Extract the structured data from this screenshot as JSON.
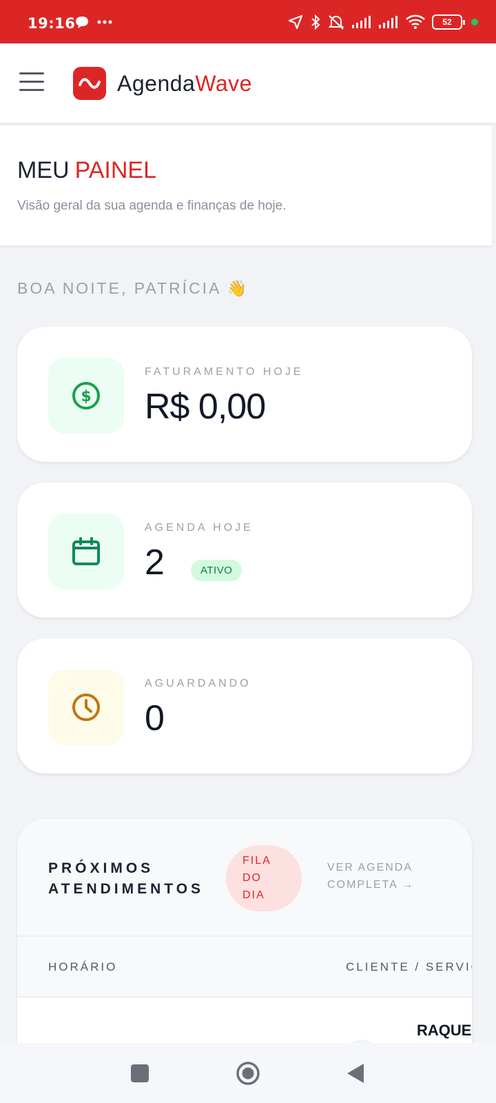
{
  "statusbar": {
    "time": "19:16",
    "battery": "52",
    "icons": [
      "chat-bubble-icon",
      "more-dots-icon",
      "location-arrow-icon",
      "bluetooth-icon",
      "mute-icon",
      "signal-icon",
      "signal-icon",
      "wifi-icon",
      "battery-icon"
    ]
  },
  "app": {
    "brand_part1": "Agenda",
    "brand_part2": "Wave",
    "accent_color": "#dc2626"
  },
  "page": {
    "title_part1": "MEU",
    "title_part2": "PAINEL",
    "subtitle": "Visão geral da sua agenda e finanças de hoje."
  },
  "greeting": "BOA NOITE, PATRÍCIA 👋",
  "stats": [
    {
      "label": "FATURAMENTO HOJE",
      "value": "R$ 0,00",
      "icon": "dollar-icon"
    },
    {
      "label": "AGENDA HOJE",
      "value": "2",
      "badge": "ATIVO",
      "icon": "calendar-icon"
    },
    {
      "label": "AGUARDANDO",
      "value": "0",
      "icon": "clock-icon"
    }
  ],
  "upcoming": {
    "title_line1": "PRÓXIMOS",
    "title_line2": "ATENDIMENTOS",
    "badge_line1": "FILA",
    "badge_line2": "DO",
    "badge_line3": "DIA",
    "link_line1": "VER AGENDA",
    "link_line2": "COMPLETA →",
    "columns": [
      "HORÁRIO",
      "CLIENTE / SERVIÇ"
    ],
    "rows": [
      {
        "client": "RAQUE"
      }
    ]
  }
}
